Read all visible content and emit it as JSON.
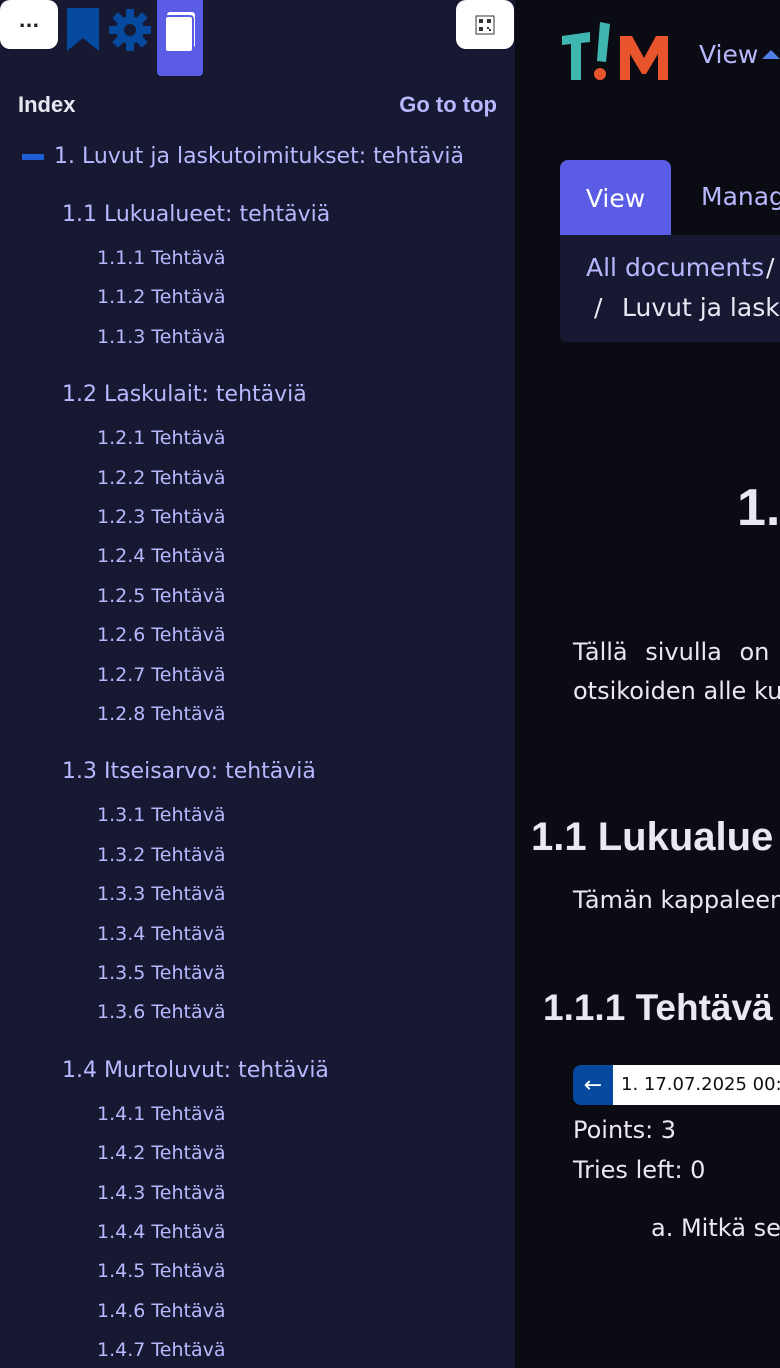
{
  "toolbar": {
    "menu_label": "...",
    "icons": [
      "ellipsis-icon",
      "bookmark-icon",
      "gear-icon",
      "book-icon",
      "qr-code-icon"
    ]
  },
  "sidebar": {
    "index_title": "Index",
    "go_to_top": "Go to top",
    "chapter": "1. Luvut ja laskutoimitukset: tehtäviä",
    "sections": [
      {
        "label": "1.1 Lukualueet: tehtäviä",
        "items": [
          "1.1.1 Tehtävä",
          "1.1.2 Tehtävä",
          "1.1.3 Tehtävä"
        ]
      },
      {
        "label": "1.2 Laskulait: tehtäviä",
        "items": [
          "1.2.1 Tehtävä",
          "1.2.2 Tehtävä",
          "1.2.3 Tehtävä",
          "1.2.4 Tehtävä",
          "1.2.5 Tehtävä",
          "1.2.6 Tehtävä",
          "1.2.7 Tehtävä",
          "1.2.8 Tehtävä"
        ]
      },
      {
        "label": "1.3 Itseisarvo: tehtäviä",
        "items": [
          "1.3.1 Tehtävä",
          "1.3.2 Tehtävä",
          "1.3.3 Tehtävä",
          "1.3.4 Tehtävä",
          "1.3.5 Tehtävä",
          "1.3.6 Tehtävä"
        ]
      },
      {
        "label": "1.4 Murtoluvut: tehtäviä",
        "items": [
          "1.4.1 Tehtävä",
          "1.4.2 Tehtävä",
          "1.4.3 Tehtävä",
          "1.4.4 Tehtävä",
          "1.4.5 Tehtävä",
          "1.4.6 Tehtävä",
          "1.4.7 Tehtävä"
        ]
      }
    ]
  },
  "header": {
    "view_menu": "View",
    "tabs": {
      "view": "View",
      "manage": "Manag"
    },
    "breadcrumb": {
      "all": "All documents",
      "sep": "/",
      "doc": "Luvut ja lasku"
    }
  },
  "content": {
    "title": "1.",
    "intro_line1": "Tällä sivulla on",
    "intro_line2": "otsikoiden alle ku",
    "h2": "1.1 Lukualue",
    "p_1_1": "Tämän kappaleen",
    "h3": "1.1.1 Tehtävä",
    "answer_prev": "←",
    "answer_select": "1. 17.07.2025 00:4",
    "points": "Points: 3",
    "tries": "Tries left: 0",
    "question": "a. Mitkä se"
  },
  "colors": {
    "sidebar_bg": "#161931",
    "main_bg": "#0b0b13",
    "accent": "#5b5ce6",
    "link": "#b8b8ff",
    "dark_blue": "#064aa0",
    "logo_teal": "#3fb6b0",
    "logo_orange": "#e8542c"
  }
}
